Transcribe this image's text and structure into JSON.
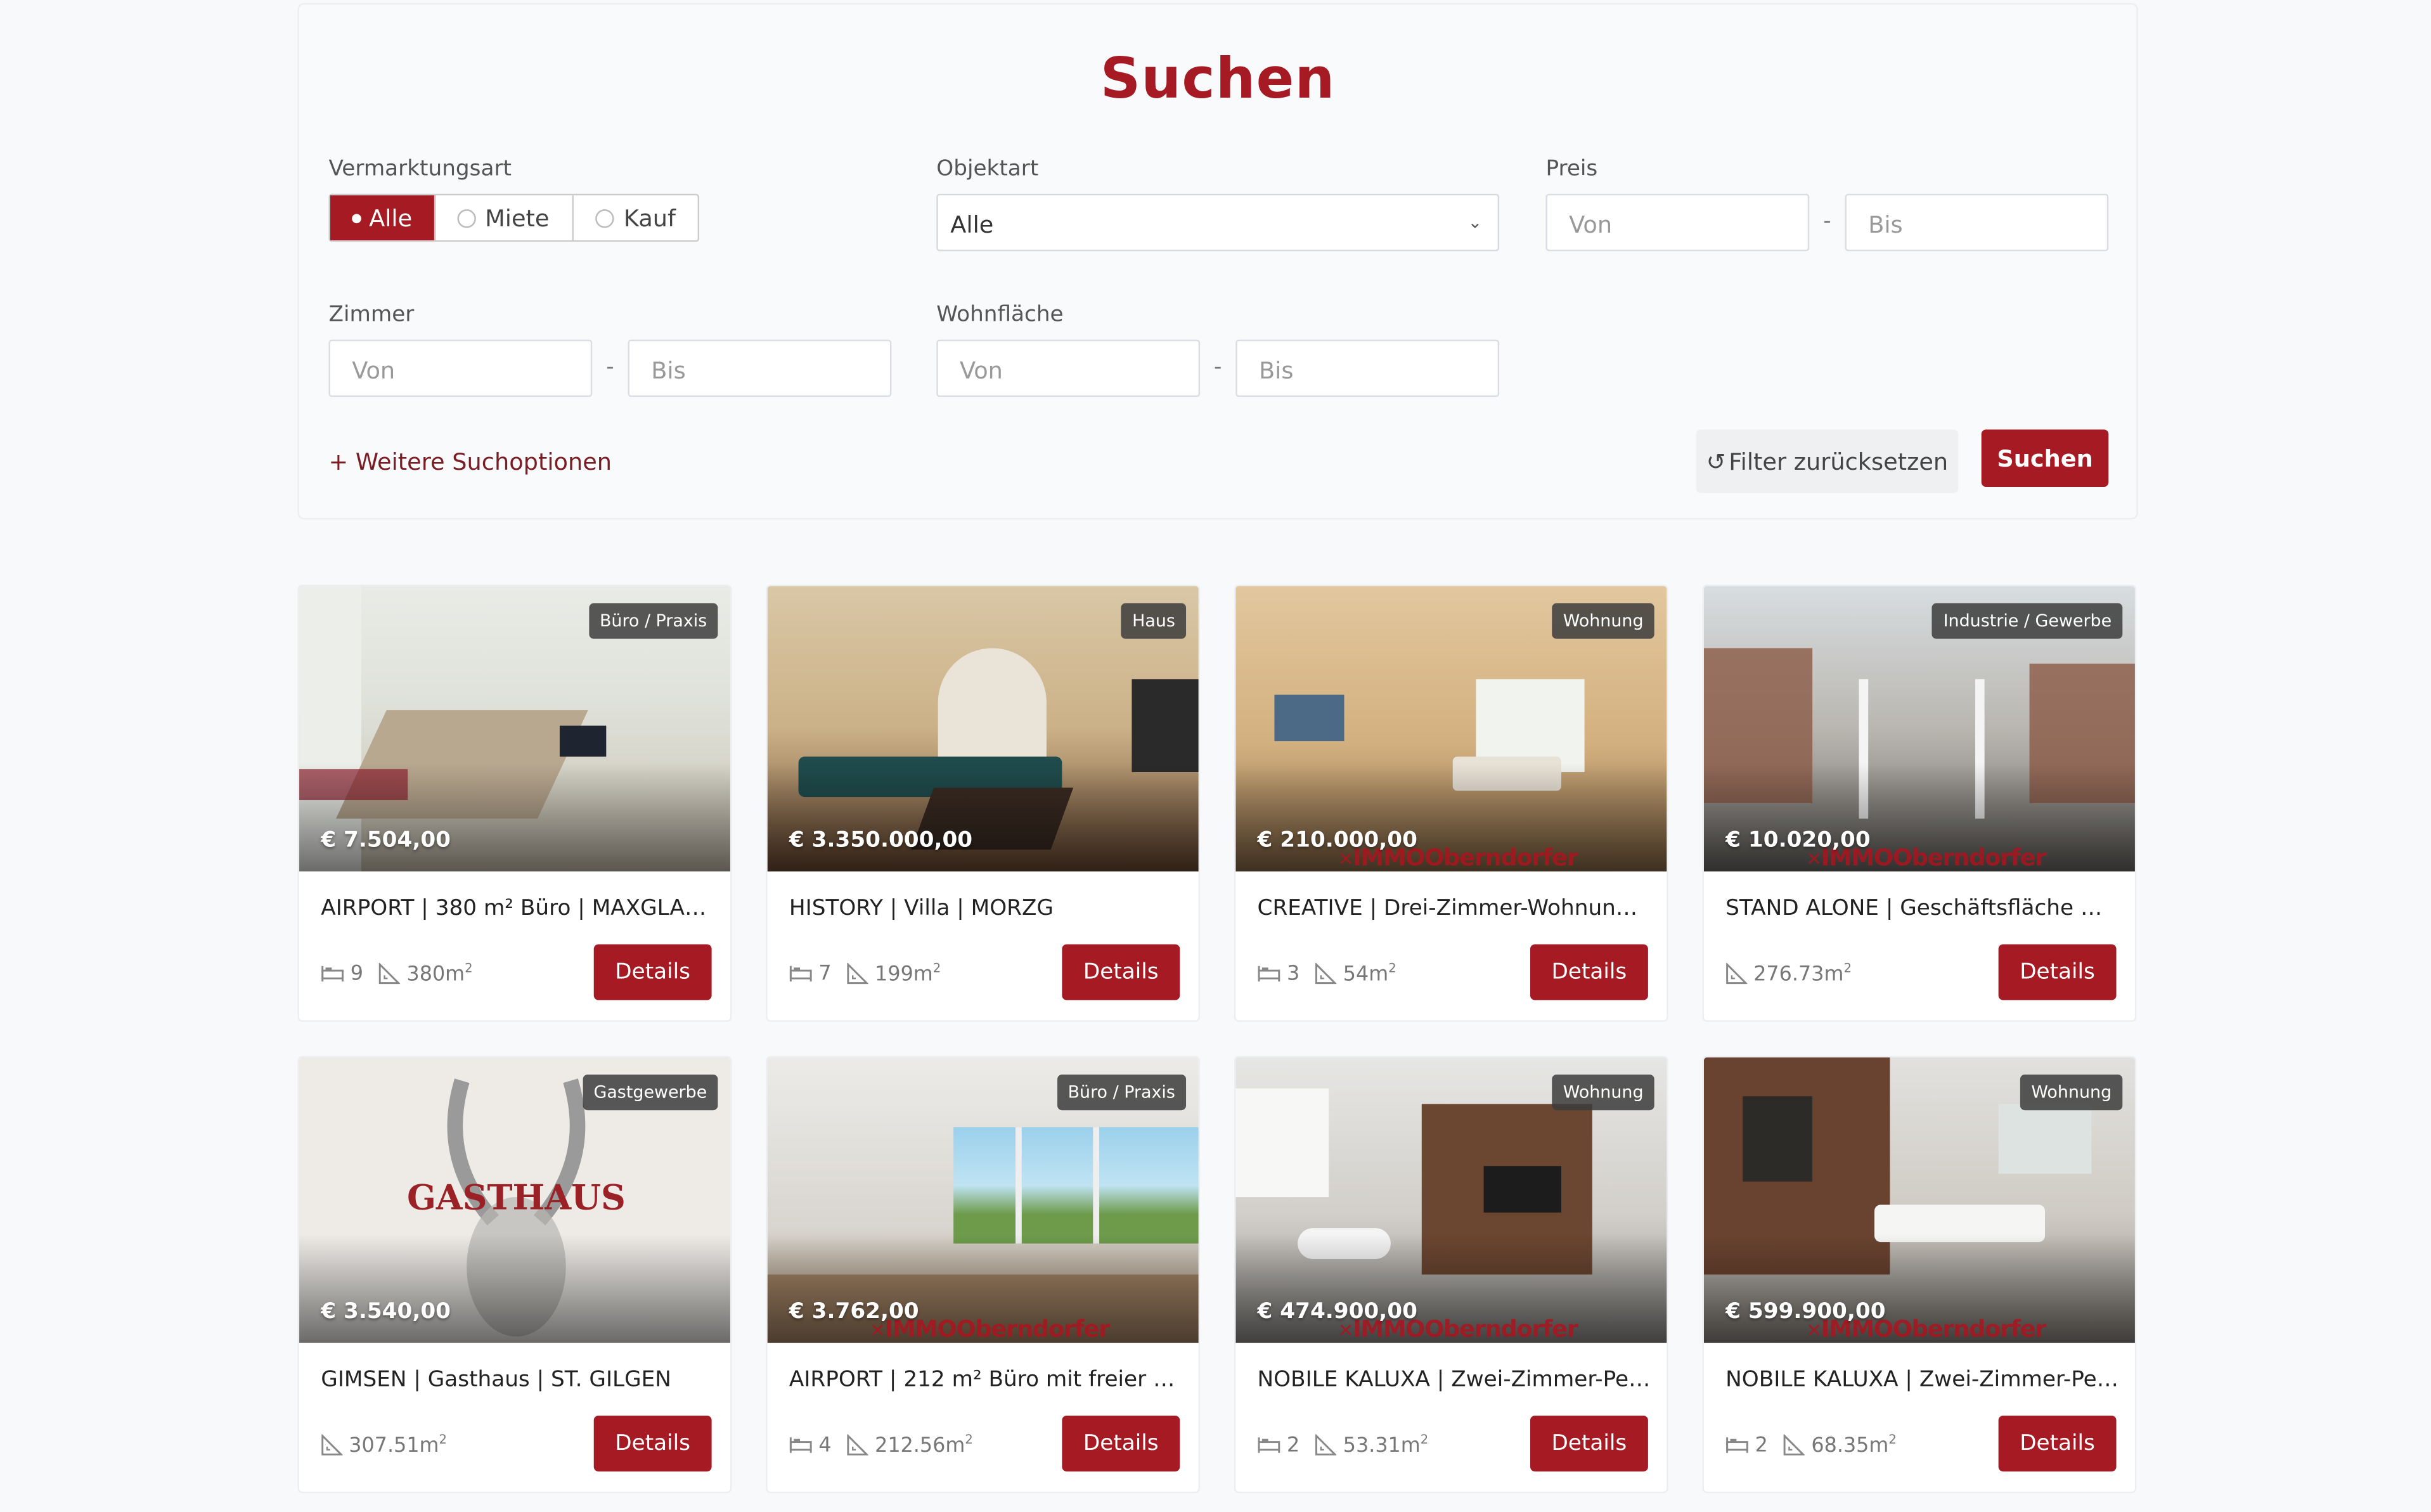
{
  "search": {
    "title": "Suchen",
    "vermarktungsart_label": "Vermarktungsart",
    "options": [
      "Alle",
      "Miete",
      "Kauf"
    ],
    "objektart_label": "Objektart",
    "objektart_value": "Alle",
    "preis_label": "Preis",
    "zimmer_label": "Zimmer",
    "wohnflaeche_label": "Wohnfläche",
    "from_placeholder": "Von",
    "to_placeholder": "Bis",
    "separator": "-",
    "more_options": "+ Weitere Suchoptionen",
    "reset_label": "Filter zurücksetzen",
    "search_button": "Suchen"
  },
  "colors": {
    "accent": "#a51a23"
  },
  "watermark": "IMMOOberndorfer",
  "listings": [
    {
      "badge": "Büro / Praxis",
      "price": "€ 7.504,00",
      "title": "AIRPORT | 380 m² Büro | MAXGLAN-...",
      "rooms": "9",
      "area": "380m",
      "details": "Details"
    },
    {
      "badge": "Haus",
      "price": "€ 3.350.000,00",
      "title": "HISTORY | Villa | MORZG",
      "rooms": "7",
      "area": "199m",
      "details": "Details"
    },
    {
      "badge": "Wohnung",
      "price": "€ 210.000,00",
      "title": "CREATIVE | Drei-Zimmer-Wohnung | L...",
      "rooms": "3",
      "area": "54m",
      "details": "Details"
    },
    {
      "badge": "Industrie / Gewerbe",
      "price": "€ 10.020,00",
      "title": "STAND ALONE | Geschäftsfläche mit B...",
      "rooms": "",
      "area": "276.73m",
      "details": "Details"
    },
    {
      "badge": "Gastgewerbe",
      "price": "€ 3.540,00",
      "title": "GIMSEN | Gasthaus | ST. GILGEN",
      "rooms": "",
      "area": "307.51m",
      "details": "Details",
      "image_text": "GASTHAUS"
    },
    {
      "badge": "Büro / Praxis",
      "price": "€ 3.762,00",
      "title": "AIRPORT | 212 m² Büro mit freier Gest...",
      "rooms": "4",
      "area": "212.56m",
      "details": "Details"
    },
    {
      "badge": "Wohnung",
      "price": "€ 474.900,00",
      "title": "NOBILE KALUXA | Zwei-Zimmer-Penth...",
      "rooms": "2",
      "area": "53.31m",
      "details": "Details"
    },
    {
      "badge": "Wohnung",
      "price": "€ 599.900,00",
      "title": "NOBILE KALUXA | Zwei-Zimmer-Penth...",
      "rooms": "2",
      "area": "68.35m",
      "details": "Details"
    }
  ]
}
